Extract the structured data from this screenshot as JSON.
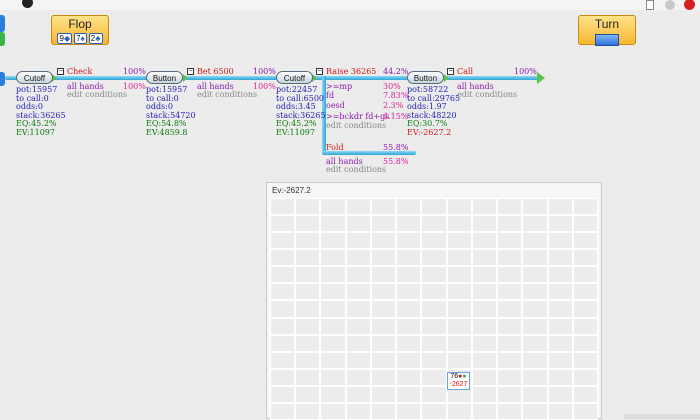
{
  "streets": {
    "flop": "Flop",
    "turn": "Turn"
  },
  "board": [
    {
      "rank": "9",
      "suit": "◆"
    },
    {
      "rank": "7",
      "suit": "♠"
    },
    {
      "rank": "2",
      "suit": "♣"
    }
  ],
  "nodes": {
    "cutoff1": {
      "name": "Cutoff",
      "pot": "pot:15957",
      "to_call": "to call:0",
      "odds": "odds:0",
      "stack": "stack:36265",
      "eq": "EQ:45.2%",
      "ev": "EV:11097"
    },
    "button1": {
      "name": "Button",
      "pot": "pot:15957",
      "to_call": "to call:0",
      "odds": "odds:0",
      "stack": "stack:54720",
      "eq": "EQ:54.8%",
      "ev": "EV:4859.8"
    },
    "cutoff2": {
      "name": "Cutoff",
      "pot": "pot:22457",
      "to_call": "to call:6500",
      "odds": "odds:3.45",
      "stack": "stack:36265",
      "eq": "EQ:45.2%",
      "ev": "EV:11097"
    },
    "button2": {
      "name": "Button",
      "pot": "pot:58722",
      "to_call": "to call:29765",
      "odds": "odds:1.97",
      "stack": "stack:48220",
      "eq": "EQ:30.7%",
      "ev": "EV:-2627.2"
    }
  },
  "actions": {
    "check": {
      "label": "Check",
      "pct": "100%",
      "hands": "all hands",
      "hands_pct": "100%",
      "edit": "edit conditions"
    },
    "bet": {
      "label": "Bet 6500",
      "pct": "100%",
      "hands": "all hands",
      "hands_pct": "100%",
      "edit": "edit conditions"
    },
    "raise": {
      "label": "Raise 36265",
      "pct": "44.2%",
      "conditions": [
        {
          "label": ">=mp",
          "pct": "30%"
        },
        {
          "label": "fd",
          "pct": "7.83%"
        },
        {
          "label": "oesd",
          "pct": "2.3%"
        },
        {
          "label": ">=bckdr fd+gs",
          "pct": "4.15%"
        }
      ],
      "edit": "edit conditions"
    },
    "fold": {
      "label": "Fold",
      "pct": "55.8%",
      "hands": "all hands",
      "hands_pct": "55.8%",
      "edit": "edit conditions"
    },
    "call": {
      "label": "Call",
      "pct": "100%",
      "hands": "all hands",
      "edit": "edit conditions"
    }
  },
  "ev_panel": {
    "title": "Ev:-2627.2",
    "hand": "76",
    "hand_ev": "-2627"
  },
  "colors": {
    "accent_line": "#2fa6d6",
    "street_yellow": "#f7b730",
    "node_green": "#5cc24a"
  }
}
